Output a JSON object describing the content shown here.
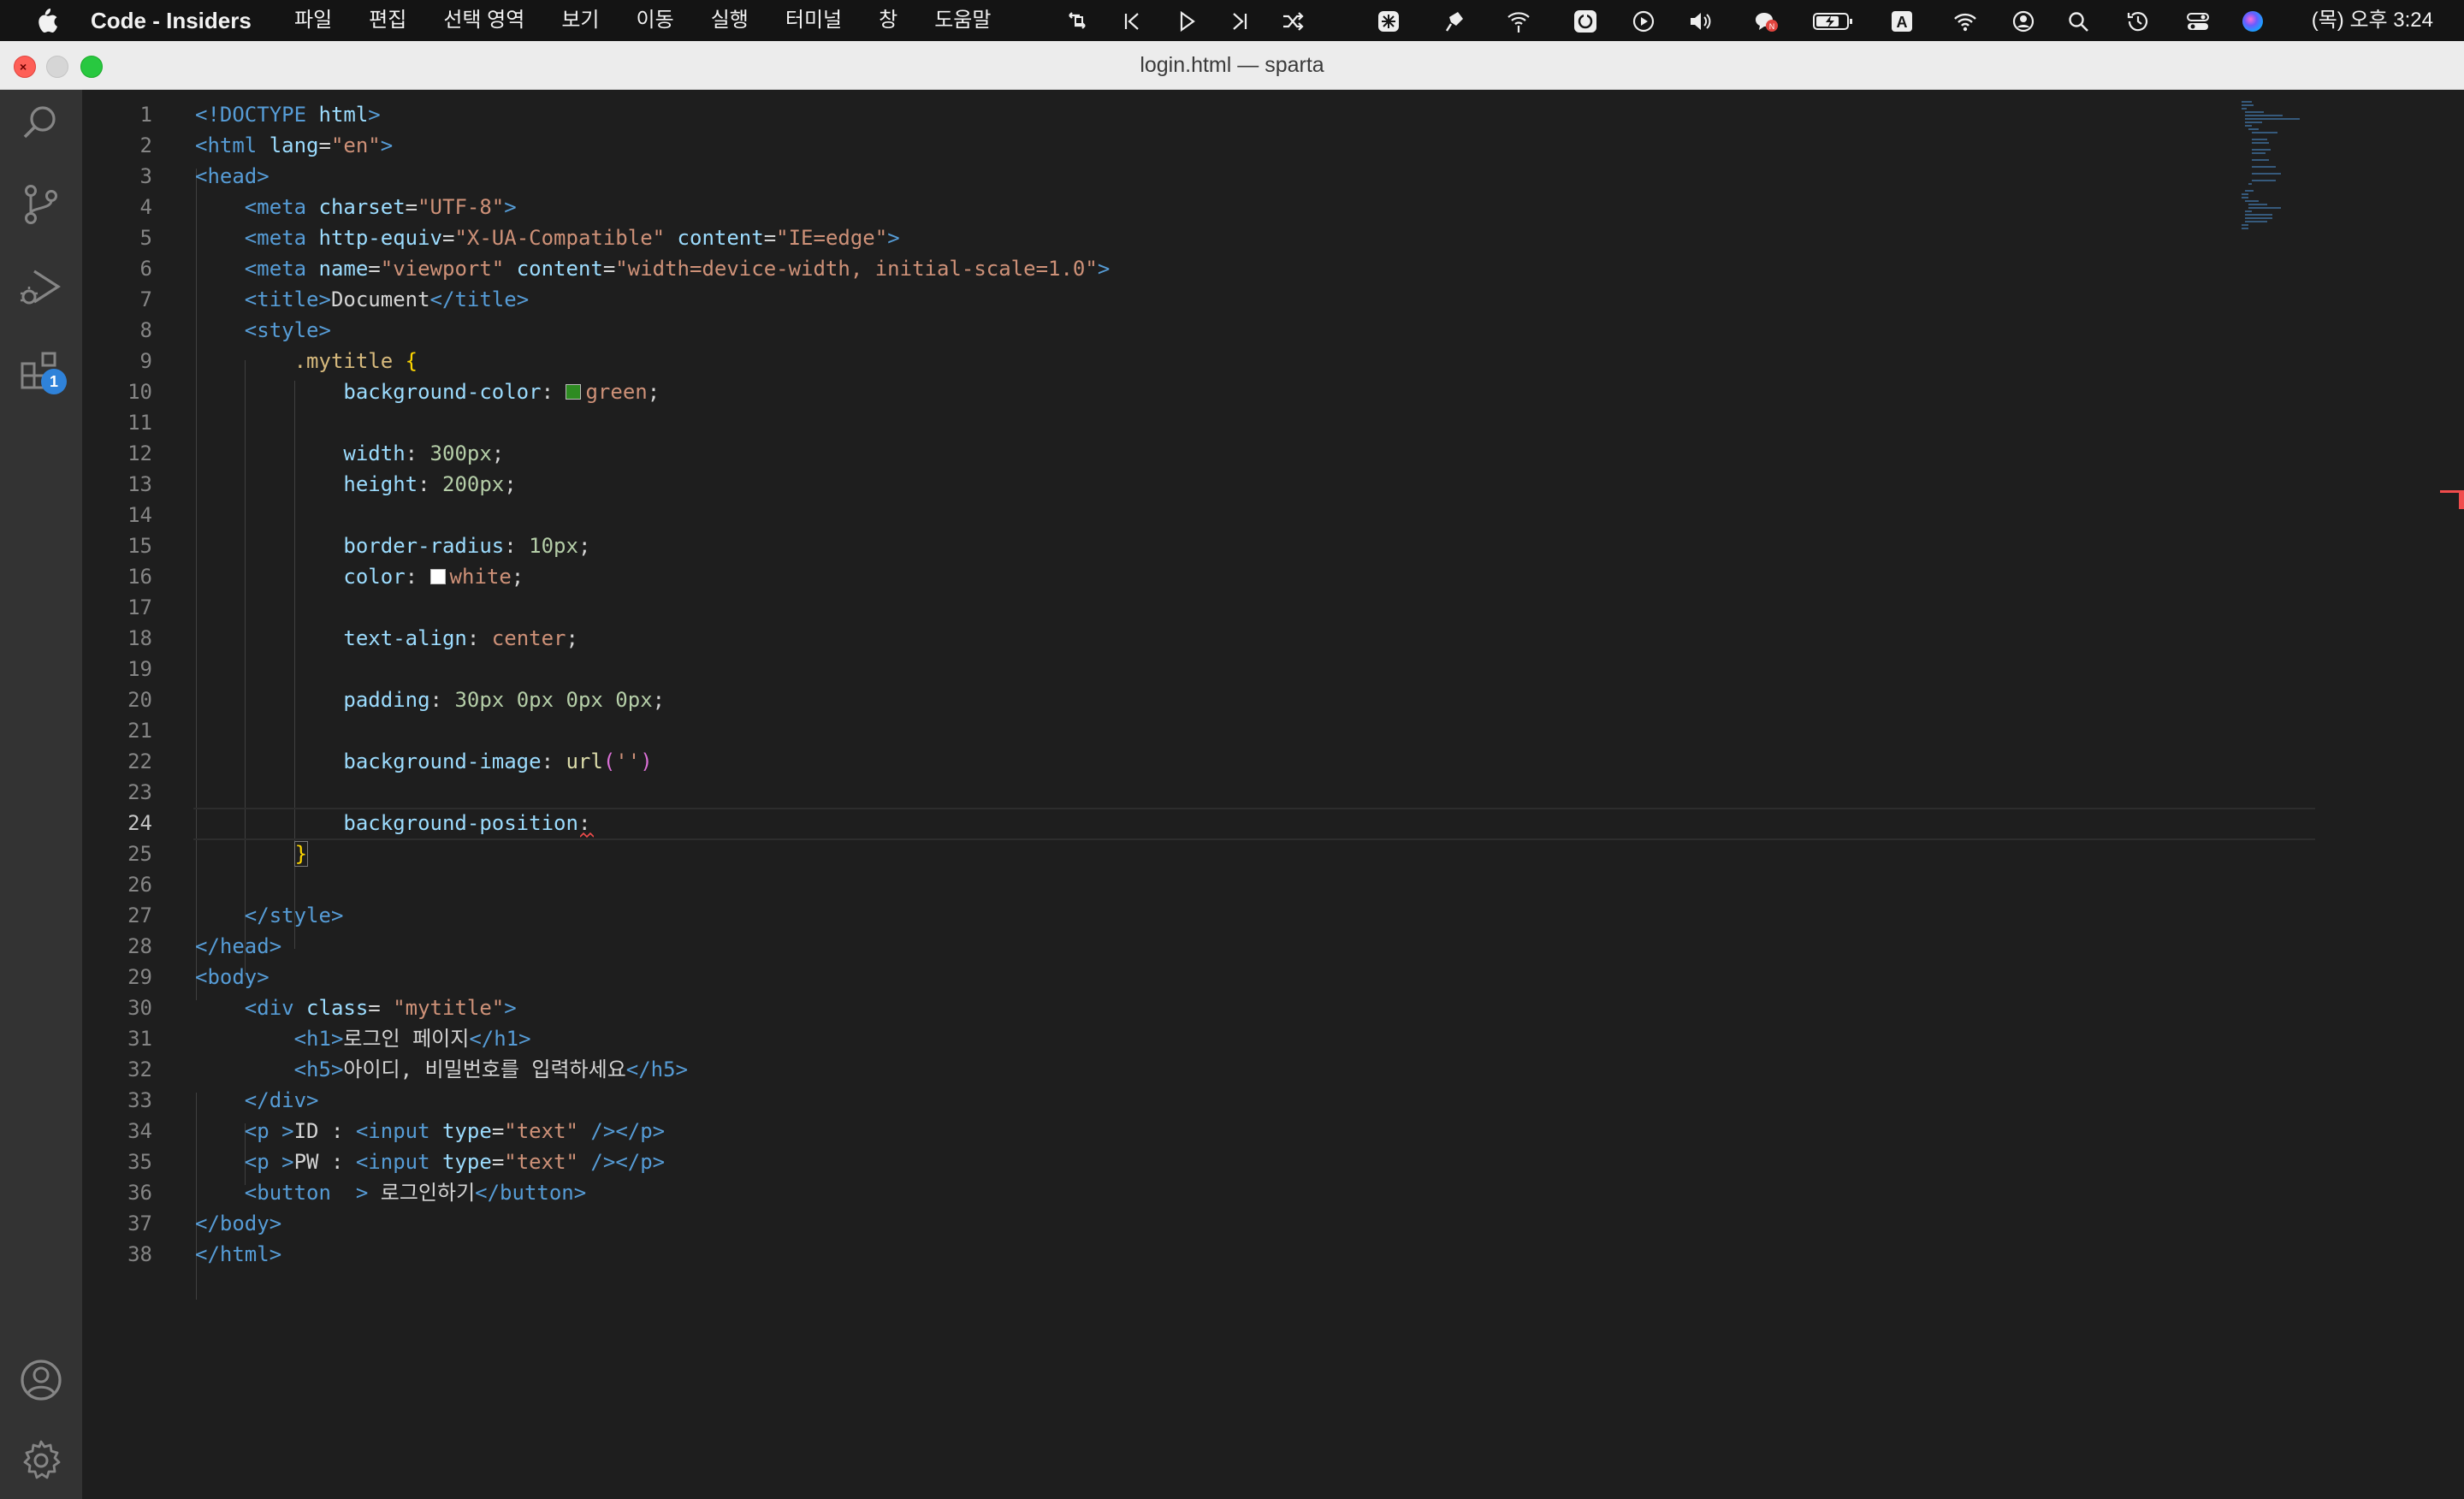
{
  "menubar": {
    "app_name": "Code - Insiders",
    "menu_items": [
      "파일",
      "편집",
      "선택 영역",
      "보기",
      "이동",
      "실행",
      "터미널",
      "창",
      "도움말"
    ],
    "clock": "(목) 오후 3:24",
    "tray_icons": [
      "remote-icon",
      "skip-back-icon",
      "play-icon",
      "skip-forward-icon",
      "shuffle-icon",
      "snowflake-icon",
      "pin-icon",
      "wifi-signal-icon",
      "refresh-app-icon",
      "play-circle-icon",
      "volume-icon",
      "chat-icon",
      "battery-icon",
      "input-source-icon",
      "wifi-icon",
      "user-circle-icon",
      "search-icon",
      "time-machine-icon",
      "control-center-icon",
      "siri-icon"
    ],
    "input_source": "A"
  },
  "window": {
    "title": "login.html — sparta"
  },
  "activity_bar": {
    "icons": [
      "search-icon",
      "source-control-icon",
      "run-debug-icon",
      "extensions-icon",
      "account-icon",
      "settings-gear-icon"
    ],
    "extensions_badge": "1"
  },
  "editor": {
    "current_line": 24,
    "lines": [
      [
        {
          "t": "<!DOCTYPE ",
          "c": "tg"
        },
        {
          "t": "html",
          "c": "at"
        },
        {
          "t": ">",
          "c": "tg"
        }
      ],
      [
        {
          "t": "<html ",
          "c": "tg"
        },
        {
          "t": "lang",
          "c": "at"
        },
        {
          "t": "=",
          "c": "tx"
        },
        {
          "t": "\"en\"",
          "c": "st"
        },
        {
          "t": ">",
          "c": "tg"
        }
      ],
      [
        {
          "t": "<head>",
          "c": "tg"
        }
      ],
      [
        {
          "t": "    "
        },
        {
          "t": "<meta ",
          "c": "tg"
        },
        {
          "t": "charset",
          "c": "at"
        },
        {
          "t": "=",
          "c": "tx"
        },
        {
          "t": "\"UTF-8\"",
          "c": "st"
        },
        {
          "t": ">",
          "c": "tg"
        }
      ],
      [
        {
          "t": "    "
        },
        {
          "t": "<meta ",
          "c": "tg"
        },
        {
          "t": "http-equiv",
          "c": "at"
        },
        {
          "t": "=",
          "c": "tx"
        },
        {
          "t": "\"X-UA-Compatible\"",
          "c": "st"
        },
        {
          "t": " content",
          "c": "at"
        },
        {
          "t": "=",
          "c": "tx"
        },
        {
          "t": "\"IE=edge\"",
          "c": "st"
        },
        {
          "t": ">",
          "c": "tg"
        }
      ],
      [
        {
          "t": "    "
        },
        {
          "t": "<meta ",
          "c": "tg"
        },
        {
          "t": "name",
          "c": "at"
        },
        {
          "t": "=",
          "c": "tx"
        },
        {
          "t": "\"viewport\"",
          "c": "st"
        },
        {
          "t": " content",
          "c": "at"
        },
        {
          "t": "=",
          "c": "tx"
        },
        {
          "t": "\"width=device-width, initial-scale=1.0\"",
          "c": "st"
        },
        {
          "t": ">",
          "c": "tg"
        }
      ],
      [
        {
          "t": "    "
        },
        {
          "t": "<title>",
          "c": "tg"
        },
        {
          "t": "Document",
          "c": "tx"
        },
        {
          "t": "</title>",
          "c": "tg"
        }
      ],
      [
        {
          "t": "    "
        },
        {
          "t": "<style>",
          "c": "tg"
        }
      ],
      [
        {
          "t": "        "
        },
        {
          "t": ".mytitle ",
          "c": "sel"
        },
        {
          "t": "{",
          "c": "br"
        }
      ],
      [
        {
          "t": "            "
        },
        {
          "t": "background-color",
          "c": "pr"
        },
        {
          "t": ": ",
          "c": "tx"
        },
        {
          "sw": "#2e8b22"
        },
        {
          "t": "green",
          "c": "kw"
        },
        {
          "t": ";",
          "c": "tx"
        }
      ],
      [],
      [
        {
          "t": "            "
        },
        {
          "t": "width",
          "c": "pr"
        },
        {
          "t": ": ",
          "c": "tx"
        },
        {
          "t": "300px",
          "c": "nu"
        },
        {
          "t": ";",
          "c": "tx"
        }
      ],
      [
        {
          "t": "            "
        },
        {
          "t": "height",
          "c": "pr"
        },
        {
          "t": ": ",
          "c": "tx"
        },
        {
          "t": "200px",
          "c": "nu"
        },
        {
          "t": ";",
          "c": "tx"
        }
      ],
      [],
      [
        {
          "t": "            "
        },
        {
          "t": "border-radius",
          "c": "pr"
        },
        {
          "t": ": ",
          "c": "tx"
        },
        {
          "t": "10px",
          "c": "nu"
        },
        {
          "t": ";",
          "c": "tx"
        }
      ],
      [
        {
          "t": "            "
        },
        {
          "t": "color",
          "c": "pr"
        },
        {
          "t": ": ",
          "c": "tx"
        },
        {
          "sw": "#ffffff"
        },
        {
          "t": "white",
          "c": "kw"
        },
        {
          "t": ";",
          "c": "tx"
        }
      ],
      [],
      [
        {
          "t": "            "
        },
        {
          "t": "text-align",
          "c": "pr"
        },
        {
          "t": ": ",
          "c": "tx"
        },
        {
          "t": "center",
          "c": "kw"
        },
        {
          "t": ";",
          "c": "tx"
        }
      ],
      [],
      [
        {
          "t": "            "
        },
        {
          "t": "padding",
          "c": "pr"
        },
        {
          "t": ": ",
          "c": "tx"
        },
        {
          "t": "30px 0px 0px 0px",
          "c": "nu"
        },
        {
          "t": ";",
          "c": "tx"
        }
      ],
      [],
      [
        {
          "t": "            "
        },
        {
          "t": "background-image",
          "c": "pr"
        },
        {
          "t": ": ",
          "c": "tx"
        },
        {
          "t": "url",
          "c": "fn"
        },
        {
          "t": "(",
          "c": "pu"
        },
        {
          "t": "''",
          "c": "st"
        },
        {
          "t": ")",
          "c": "pu"
        }
      ],
      [],
      [
        {
          "t": "            "
        },
        {
          "t": "background-position",
          "c": "pr"
        },
        {
          "t": ":",
          "c": "tx"
        }
      ],
      [
        {
          "t": "        "
        },
        {
          "t": "}",
          "c": "br",
          "box": true
        }
      ],
      [],
      [
        {
          "t": "    "
        },
        {
          "t": "</style>",
          "c": "tg"
        }
      ],
      [
        {
          "t": "</head>",
          "c": "tg"
        }
      ],
      [
        {
          "t": "<body>",
          "c": "tg"
        }
      ],
      [
        {
          "t": "    "
        },
        {
          "t": "<div ",
          "c": "tg"
        },
        {
          "t": "class",
          "c": "at"
        },
        {
          "t": "= ",
          "c": "tx"
        },
        {
          "t": "\"mytitle\"",
          "c": "st"
        },
        {
          "t": ">",
          "c": "tg"
        }
      ],
      [
        {
          "t": "        "
        },
        {
          "t": "<h1>",
          "c": "tg"
        },
        {
          "t": "로그인 페이지",
          "c": "tx"
        },
        {
          "t": "</h1>",
          "c": "tg"
        }
      ],
      [
        {
          "t": "        "
        },
        {
          "t": "<h5>",
          "c": "tg"
        },
        {
          "t": "아이디, 비밀번호를 입력하세요",
          "c": "tx"
        },
        {
          "t": "</h5>",
          "c": "tg"
        }
      ],
      [
        {
          "t": "    "
        },
        {
          "t": "</div>",
          "c": "tg"
        }
      ],
      [
        {
          "t": "    "
        },
        {
          "t": "<p ",
          "c": "tg"
        },
        {
          "t": ">",
          "c": "tg"
        },
        {
          "t": "ID : ",
          "c": "tx"
        },
        {
          "t": "<input ",
          "c": "tg"
        },
        {
          "t": "type",
          "c": "at"
        },
        {
          "t": "=",
          "c": "tx"
        },
        {
          "t": "\"text\"",
          "c": "st"
        },
        {
          "t": " />",
          "c": "tg"
        },
        {
          "t": "</p>",
          "c": "tg"
        }
      ],
      [
        {
          "t": "    "
        },
        {
          "t": "<p ",
          "c": "tg"
        },
        {
          "t": ">",
          "c": "tg"
        },
        {
          "t": "PW : ",
          "c": "tx"
        },
        {
          "t": "<input ",
          "c": "tg"
        },
        {
          "t": "type",
          "c": "at"
        },
        {
          "t": "=",
          "c": "tx"
        },
        {
          "t": "\"text\"",
          "c": "st"
        },
        {
          "t": " />",
          "c": "tg"
        },
        {
          "t": "</p>",
          "c": "tg"
        }
      ],
      [
        {
          "t": "    "
        },
        {
          "t": "<button ",
          "c": "tg"
        },
        {
          "t": " > ",
          "c": "tg"
        },
        {
          "t": "로그인하기",
          "c": "tx"
        },
        {
          "t": "</button>",
          "c": "tg"
        }
      ],
      [
        {
          "t": "</body>",
          "c": "tg"
        }
      ],
      [
        {
          "t": "</html>",
          "c": "tg"
        }
      ]
    ]
  }
}
